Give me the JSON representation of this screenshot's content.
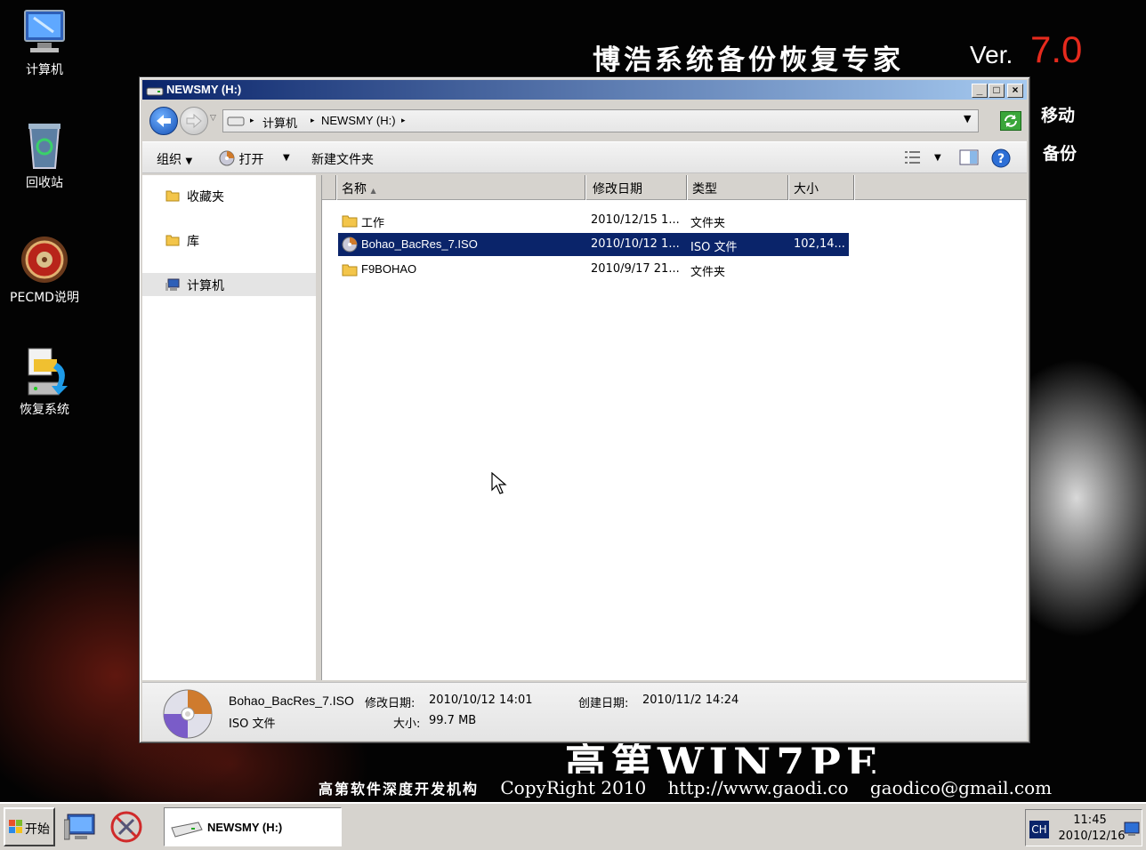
{
  "desktop": {
    "background": {
      "title": "博浩系统备份恢复专家",
      "ver_label": "Ver.",
      "ver_number": "7.0",
      "side1": "移动",
      "side2": "备份",
      "winpe": "高第WIN7PE",
      "footer_cn": "高第软件深度开发机构",
      "footer_copy": "CopyRight 2010",
      "footer_url": "http://www.gaodi.co",
      "footer_mail": "gaodico@gmail.com"
    },
    "icons": [
      {
        "label": "计算机",
        "icon": "computer-icon"
      },
      {
        "label": "回收站",
        "icon": "recycle-bin-icon"
      },
      {
        "label": "PECMD说明",
        "icon": "roulette-icon"
      },
      {
        "label": "恢复系统",
        "icon": "restore-system-icon"
      }
    ]
  },
  "window": {
    "title": "NEWSMY (H:)",
    "caption_buttons": {
      "minimize": "_",
      "maximize": "□",
      "close": "×"
    },
    "address": {
      "segments": [
        "计算机",
        "NEWSMY (H:)"
      ]
    },
    "toolbar": {
      "organize": "组织",
      "open": "打开",
      "new_folder": "新建文件夹"
    },
    "nav": {
      "favorites": "收藏夹",
      "libraries": "库",
      "computer": "计算机"
    },
    "columns": {
      "name": "名称",
      "modified": "修改日期",
      "type": "类型",
      "size": "大小"
    },
    "files": [
      {
        "name": "工作",
        "modified": "2010/12/15 1...",
        "type": "文件夹",
        "size": "",
        "icon": "folder-icon"
      },
      {
        "name": "Bohao_BacRes_7.ISO",
        "modified": "2010/10/12 1...",
        "type": "ISO 文件",
        "size": "102,14...",
        "icon": "disc-icon",
        "selected": true
      },
      {
        "name": "F9BOHAO",
        "modified": "2010/9/17 21...",
        "type": "文件夹",
        "size": "",
        "icon": "folder-icon"
      }
    ],
    "details": {
      "filename": "Bohao_BacRes_7.ISO",
      "filetype": "ISO 文件",
      "modified_label": "修改日期:",
      "modified_value": "2010/10/12 14:01",
      "size_label": "大小:",
      "size_value": "99.7 MB",
      "created_label": "创建日期:",
      "created_value": "2010/11/2 14:24"
    }
  },
  "taskbar": {
    "start_label": "开始",
    "task_window_label": "NEWSMY (H:)",
    "language": "CH",
    "time": "11:45",
    "date": "2010/12/16"
  },
  "colors": {
    "title_active_start": "#0a246a",
    "title_active_end": "#a6caf0",
    "selection": "#0a246a",
    "version_red": "#e52a1d"
  }
}
